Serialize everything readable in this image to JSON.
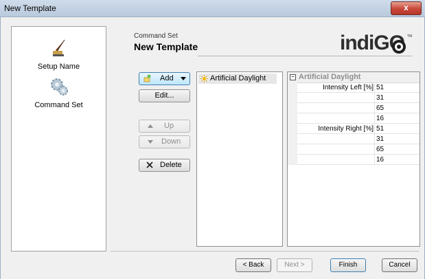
{
  "window": {
    "title": "New Template",
    "close_glyph": "x"
  },
  "sidebar": {
    "items": [
      {
        "label": "Setup Name",
        "icon": "feather-pen-icon"
      },
      {
        "label": "Command Set",
        "icon": "gears-icon"
      }
    ]
  },
  "header": {
    "subtitle": "Command Set",
    "title": "New Template",
    "logo_text": "indiGO",
    "logo_tm": "TM"
  },
  "buttons": {
    "add": "Add",
    "edit": "Edit...",
    "up": "Up",
    "down": "Down",
    "delete": "Delete"
  },
  "command_list": {
    "items": [
      {
        "label": "Artificial Daylight",
        "icon": "sun-icon"
      }
    ]
  },
  "properties": {
    "category": "Artificial Daylight",
    "rows": [
      {
        "name": "Intensity Left [%]",
        "value": "51"
      },
      {
        "name": "",
        "value": "31"
      },
      {
        "name": "",
        "value": "65"
      },
      {
        "name": "",
        "value": "16"
      },
      {
        "name": "Intensity Right [%]",
        "value": "51"
      },
      {
        "name": "",
        "value": "31"
      },
      {
        "name": "",
        "value": "65"
      },
      {
        "name": "",
        "value": "16"
      }
    ]
  },
  "footer": {
    "back": "< Back",
    "next": "Next >",
    "finish": "Finish",
    "cancel": "Cancel"
  },
  "colors": {
    "titlebar": "#c4d3e3",
    "close": "#c6483a",
    "accent": "#3c7fb1"
  }
}
